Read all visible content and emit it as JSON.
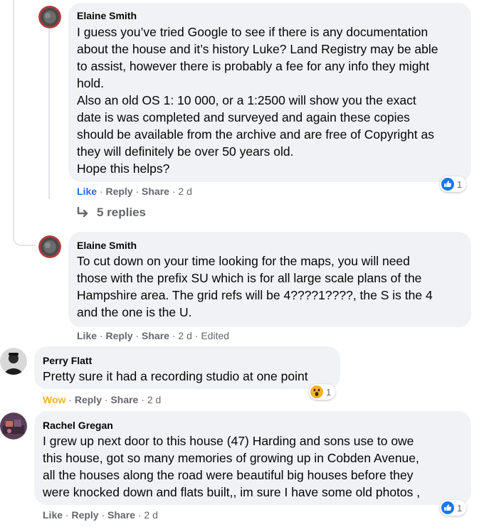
{
  "comments": [
    {
      "author": "Elaine Smith",
      "lines": [
        "I guess you’ve tried Google to see if there is any documentation",
        "about the house and it’s history Luke? Land Registry may be able",
        "to assist, however there is probably a fee for any info they might",
        "hold.",
        "Also an old OS 1: 10 000, or a 1:2500 will show you the exact",
        "date is was completed and surveyed and again these copies",
        "should be available from the archive and are free of Copyright as",
        "they will definitely be over 50 years old.",
        "Hope this helps?"
      ],
      "actions": {
        "like": "Like",
        "reply": "Reply",
        "share": "Share",
        "time": "2 d"
      },
      "reaction": {
        "icon": "like-reaction-icon",
        "count": "1"
      },
      "replies_label": "5 replies"
    },
    {
      "author": "Elaine Smith",
      "lines": [
        "To cut down on your time looking for the maps, you will need",
        "those with the prefix SU which is for all large scale plans of the",
        "Hampshire area. The grid refs will be 4????1????, the S is the 4",
        "and the one is the U."
      ],
      "actions": {
        "like": "Like",
        "reply": "Reply",
        "share": "Share",
        "time": "2 d",
        "edited": "Edited"
      }
    },
    {
      "author": "Perry Flatt",
      "lines": [
        "Pretty sure it had a recording studio at one point"
      ],
      "actions": {
        "like": "Wow",
        "reply": "Reply",
        "share": "Share",
        "time": "2 d"
      },
      "reaction": {
        "icon": "wow-reaction-icon",
        "count": "1"
      }
    },
    {
      "author": "Rachel Gregan",
      "lines": [
        "I grew up next door to this house (47) Harding and sons use to owe",
        "this house, got so many memories of growing up in Cobden Avenue,",
        "all the houses along the road were beautiful big houses before they",
        "were knocked down and flats built,, im sure I have some old photos ,"
      ],
      "actions": {
        "like": "Like",
        "reply": "Reply",
        "share": "Share",
        "time": "2 d"
      },
      "reaction": {
        "icon": "like-reaction-icon",
        "count": "1"
      }
    }
  ],
  "separator": "·",
  "colors": {
    "bubble": "#f0f2f5",
    "like_active": "#216fdb",
    "wow_active": "#f7b125",
    "meta": "#65676b"
  }
}
